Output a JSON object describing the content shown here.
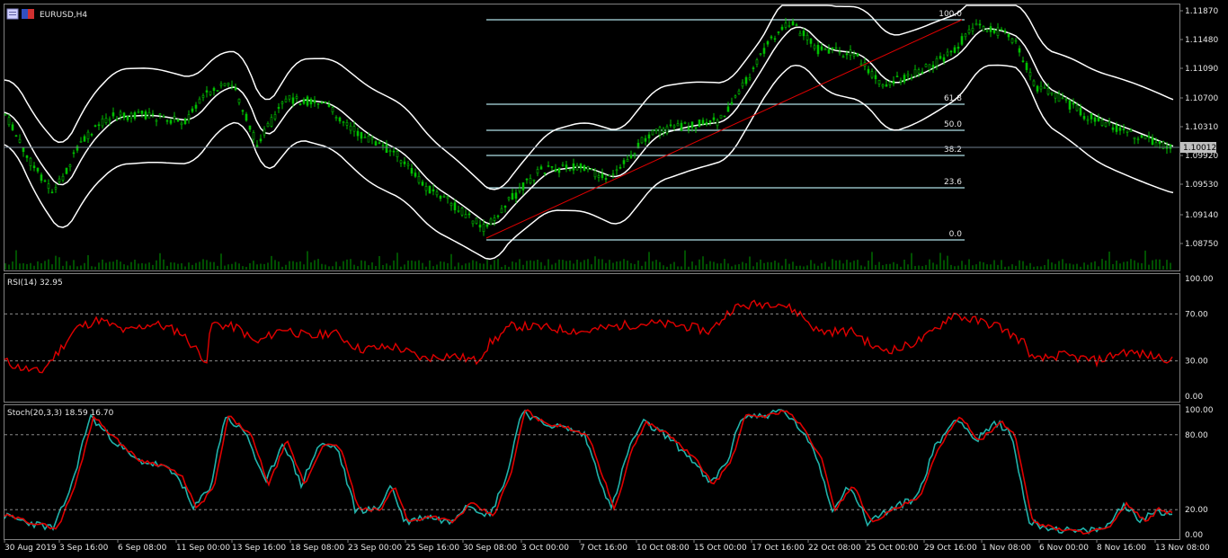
{
  "window": {
    "symbol_title": "EURUSD,H4"
  },
  "price_axis": {
    "ticks": [
      "1.11870",
      "1.11480",
      "1.11090",
      "1.10700",
      "1.10310",
      "1.09920",
      "1.09530",
      "1.09140",
      "1.08750"
    ],
    "current_price": "1.10012"
  },
  "fibonacci": {
    "levels": [
      "100.0",
      "61.8",
      "50.0",
      "38.2",
      "23.6",
      "0.0"
    ]
  },
  "rsi": {
    "label": "RSI(14) 32.95",
    "ticks": [
      "100.00",
      "70.00",
      "30.00",
      "0.00"
    ]
  },
  "stoch": {
    "label": "Stoch(20,3,3) 18.59 16.70",
    "ticks": [
      "100.00",
      "80.00",
      "20.00",
      "0.00"
    ]
  },
  "time_axis": {
    "labels": [
      "30 Aug 2019",
      "3 Sep 16:00",
      "6 Sep 08:00",
      "11 Sep 00:00",
      "13 Sep 16:00",
      "18 Sep 08:00",
      "23 Sep 00:00",
      "25 Sep 16:00",
      "30 Sep 08:00",
      "3 Oct 00:00",
      "7 Oct 16:00",
      "10 Oct 08:00",
      "15 Oct 00:00",
      "17 Oct 16:00",
      "22 Oct 08:00",
      "25 Oct 00:00",
      "29 Oct 16:00",
      "1 Nov 08:00",
      "6 Nov 00:00",
      "8 Nov 16:00",
      "13 Nov 08:00"
    ]
  },
  "colors": {
    "background": "#000000",
    "candles": "#00c000",
    "bands": "#ffffff",
    "fib": "#b0e0e6",
    "trend": "#dd0000",
    "rsi": "#e00000",
    "stoch_main": "#20b2aa",
    "stoch_signal": "#e00000",
    "volume": "#00a000",
    "price_tag_bg": "#c0c0c0"
  },
  "icons": [
    "chart-window-icon",
    "flag-icon"
  ]
}
